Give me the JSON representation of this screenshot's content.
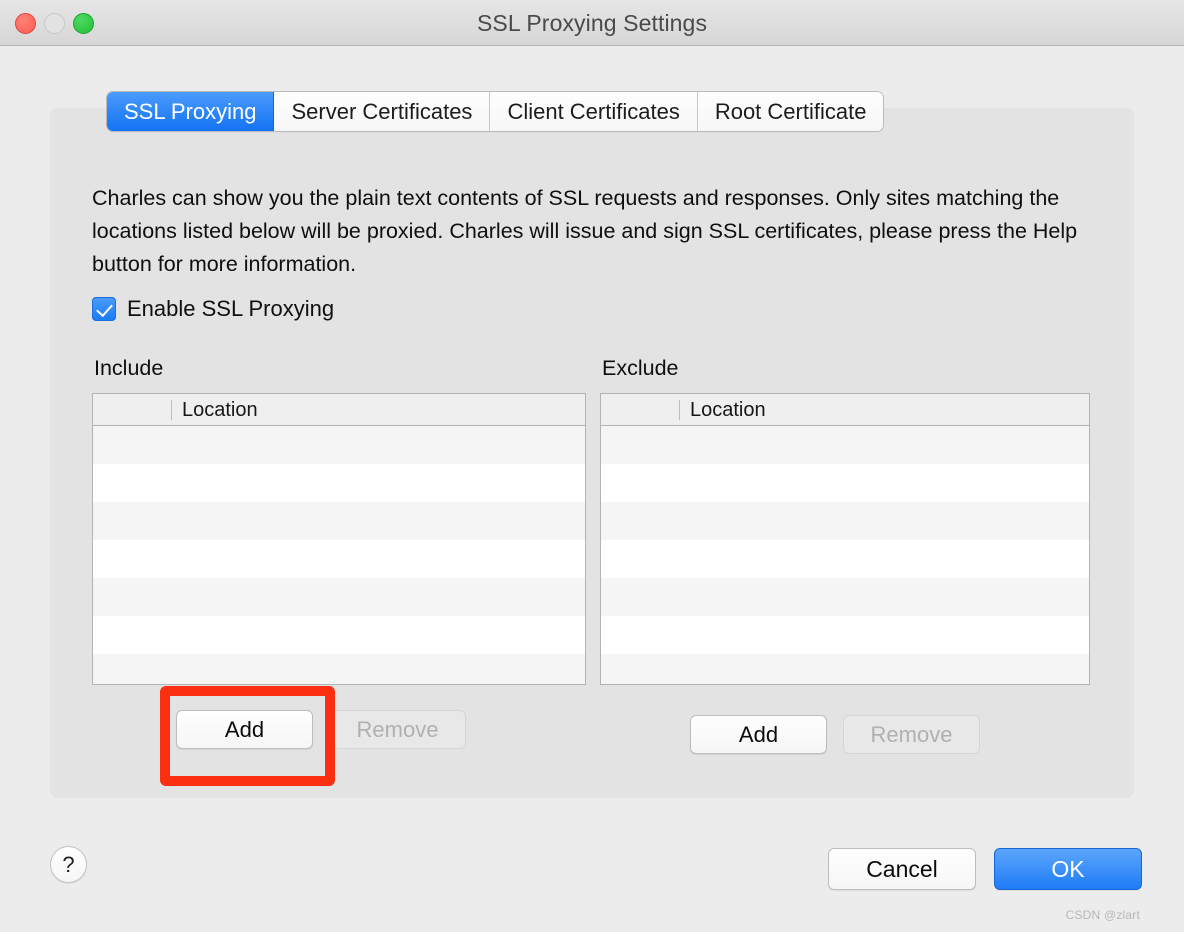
{
  "window": {
    "title": "SSL Proxying Settings",
    "traffic_lights": [
      "close",
      "minimize",
      "zoom"
    ]
  },
  "tabs": [
    {
      "label": "SSL Proxying",
      "active": true
    },
    {
      "label": "Server Certificates",
      "active": false
    },
    {
      "label": "Client Certificates",
      "active": false
    },
    {
      "label": "Root Certificate",
      "active": false
    }
  ],
  "main": {
    "description": "Charles can show you the plain text contents of SSL requests and responses. Only sites matching the locations listed below will be proxied. Charles will issue and sign SSL certificates, please press the Help button for more information.",
    "enable_checkbox": {
      "label": "Enable SSL Proxying",
      "checked": true
    },
    "include": {
      "title": "Include",
      "column_header": "Location",
      "rows": [],
      "add_label": "Add",
      "remove_label": "Remove",
      "remove_disabled": true
    },
    "exclude": {
      "title": "Exclude",
      "column_header": "Location",
      "rows": [],
      "add_label": "Add",
      "remove_label": "Remove",
      "remove_disabled": true
    }
  },
  "footer": {
    "help_label": "?",
    "cancel_label": "Cancel",
    "ok_label": "OK"
  },
  "annotation": {
    "highlight_color": "#fb2f12",
    "target": "include-add-button"
  },
  "watermark": "CSDN @zlart",
  "colors": {
    "accent_blue": "#1374f4",
    "window_bg": "#ececec",
    "panel_bg": "#e3e3e3",
    "row_alt": "#f5f5f5"
  }
}
